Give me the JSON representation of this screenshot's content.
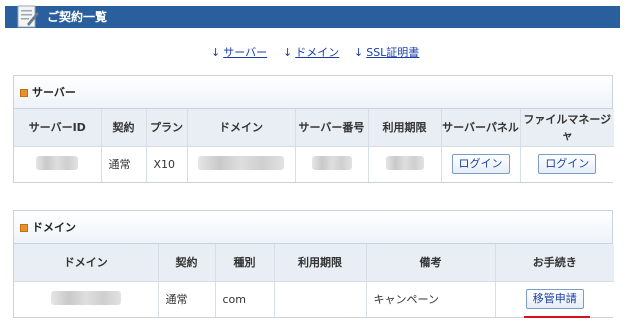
{
  "page": {
    "title": "ご契約一覧"
  },
  "anchors": {
    "server": "サーバー",
    "domain": "ドメイン",
    "ssl": "SSL証明書"
  },
  "server_section": {
    "heading": "サーバー",
    "columns": [
      "サーバーID",
      "契約",
      "プラン",
      "ドメイン",
      "サーバー番号",
      "利用期限",
      "サーバーパネル",
      "ファイルマネージャ"
    ],
    "row": {
      "contract": "通常",
      "plan": "X10",
      "panel_button": "ログイン",
      "file_manager_button": "ログイン"
    }
  },
  "domain_section": {
    "heading": "ドメイン",
    "columns": [
      "ドメイン",
      "契約",
      "種別",
      "利用期限",
      "備考",
      "お手続き"
    ],
    "row": {
      "contract": "通常",
      "type": "com",
      "expiry": "",
      "note": "キャンペーン",
      "action_button": "移管申請"
    }
  },
  "colors": {
    "title_bar": "#2a5f9e",
    "link": "#1a3ea8",
    "highlight": "#d4121e",
    "section_marker": "#e8912a"
  }
}
